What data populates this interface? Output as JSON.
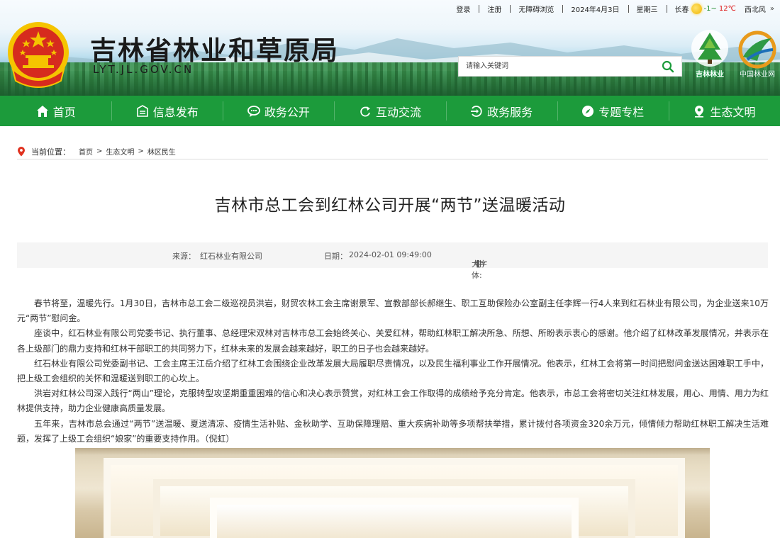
{
  "topbar": {
    "login": "登录",
    "register": "注册",
    "accessibility": "无障碍浏览",
    "date": "2024年4月3日",
    "weekday": "星期三",
    "city": "长春",
    "temp_low": "-1~",
    "temp_high": "12℃",
    "wind": "西北风",
    "more": "»"
  },
  "header": {
    "title": "吉林省林业和草原局",
    "domain": "LYT.JL.GOV.CN",
    "search_placeholder": "请输入关键词",
    "logo1_label": "吉林林业",
    "logo2_label": "中国林业网"
  },
  "nav": {
    "items": [
      {
        "label": "首页",
        "icon": "home-icon"
      },
      {
        "label": "信息发布",
        "icon": "news-icon"
      },
      {
        "label": "政务公开",
        "icon": "chat-icon"
      },
      {
        "label": "互动交流",
        "icon": "refresh-icon"
      },
      {
        "label": "政务服务",
        "icon": "service-icon"
      },
      {
        "label": "专题专栏",
        "icon": "compass-icon"
      },
      {
        "label": "生态文明",
        "icon": "location-icon"
      }
    ]
  },
  "breadcrumb": {
    "label": "当前位置：",
    "items": [
      "首页",
      "生态文明",
      "林区民生"
    ],
    "sep": ">"
  },
  "article": {
    "title": "吉林市总工会到红林公司开展“两节”送温暖活动",
    "source_label": "来源：",
    "source": "红石林业有限公司",
    "date_label": "日期：",
    "date": "2024-02-01 09:49:00",
    "font_label": "【字体:",
    "font_large": "大",
    "font_medium": "中",
    "font_small": "小",
    "font_close": "】",
    "paragraphs": [
      "春节将至，温暖先行。1月30日，吉林市总工会二级巡视员洪岩，财贸农林工会主席谢景军、宣教部部长郝继生、职工互助保险办公室副主任李辉一行4人来到红石林业有限公司，为企业送来10万元“两节”慰问金。",
      "座谈中，红石林业有限公司党委书记、执行董事、总经理宋双林对吉林市总工会始终关心、关爱红林，帮助红林职工解决所急、所想、所盼表示衷心的感谢。他介绍了红林改革发展情况，并表示在各上级部门的鼎力支持和红林干部职工的共同努力下，红林未来的发展会越来越好，职工的日子也会越来越好。",
      "红石林业有限公司党委副书记、工会主席王江岳介绍了红林工会围绕企业改革发展大局履职尽责情况，以及民生福利事业工作开展情况。他表示，红林工会将第一时间把慰问金送达困难职工手中，把上级工会组织的关怀和温暖送到职工的心坎上。",
      "洪岩对红林公司深入践行“两山”理论，克服转型攻坚期重重困难的信心和决心表示赞赏，对红林工会工作取得的成绩给予充分肯定。他表示，市总工会将密切关注红林发展，用心、用情、用力为红林提供支持，助力企业健康高质量发展。",
      "五年来，吉林市总会通过“两节”送温暖、夏送清凉、疫情生活补贴、金秋助学、互助保障理赔、重大疾病补助等多项帮扶举措，累计拨付各项资金320余万元，倾情倾力帮助红林职工解决生活难题，发挥了上级工会组织“娘家”的重要支持作用。（倪虹）"
    ]
  },
  "colors": {
    "nav_green": "#1c9b3b",
    "search_icon_green": "#1c9b3b",
    "emblem_red": "#d62b1e",
    "emblem_gold": "#f5c400"
  }
}
